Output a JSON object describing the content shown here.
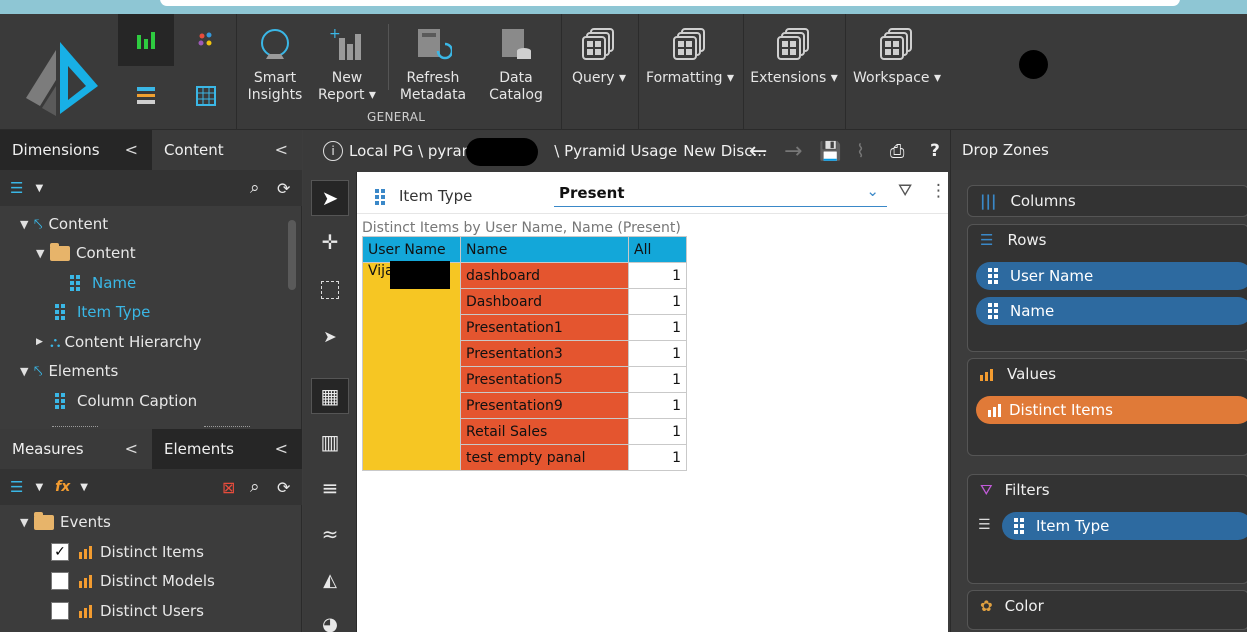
{
  "ribbon": {
    "buttons": [
      {
        "label": "Smart\nInsights"
      },
      {
        "label": "New\nReport ▾"
      },
      {
        "label": "Refresh\nMetadata"
      },
      {
        "label": "Data\nCatalog"
      },
      {
        "label": "Query ▾"
      },
      {
        "label": "Formatting ▾"
      },
      {
        "label": "Extensions ▾"
      },
      {
        "label": "Workspace ▾"
      }
    ],
    "group_label": "GENERAL"
  },
  "left": {
    "tab_dimensions": "Dimensions",
    "tab_content": "Content",
    "tree": [
      "Content",
      "Content",
      "Name",
      "Item Type",
      "Content Hierarchy",
      "Elements",
      "Column Caption"
    ],
    "tab_measures": "Measures",
    "tab_elements": "Elements",
    "measures_tree": [
      "Events",
      "Distinct Items",
      "Distinct Models",
      "Distinct Users"
    ],
    "checked": "✓"
  },
  "breadcrumb": {
    "part1": "Local PG \\ pyram",
    "part2": "\\ Pyramid Usage",
    "part3": "New Disc..."
  },
  "filter": {
    "label": "Item Type",
    "value": "Present"
  },
  "report": {
    "title": "Distinct Items by User Name, Name (Present)",
    "columns": [
      "User Name",
      "Name",
      "All"
    ],
    "user": "Vija",
    "rows": [
      {
        "name": "dashboard",
        "value": "1"
      },
      {
        "name": "Dashboard",
        "value": "1"
      },
      {
        "name": "Presentation1",
        "value": "1"
      },
      {
        "name": "Presentation3",
        "value": "1"
      },
      {
        "name": "Presentation5",
        "value": "1"
      },
      {
        "name": "Presentation9",
        "value": "1"
      },
      {
        "name": "Retail Sales",
        "value": "1"
      },
      {
        "name": "test empty panal",
        "value": "1"
      }
    ]
  },
  "dropzones": {
    "title": "Drop Zones",
    "columns": "Columns",
    "rows": "Rows",
    "rows_items": [
      "User Name",
      "Name"
    ],
    "values": "Values",
    "values_items": [
      "Distinct Items"
    ],
    "filters": "Filters",
    "filters_items": [
      "Item Type"
    ],
    "color": "Color"
  },
  "colors": {
    "accent": "#3ab7e6",
    "header_blue": "#13a7d9",
    "cell_orange": "#e4552f",
    "cell_yellow": "#f6c623",
    "pill_blue": "#2d6aa0",
    "pill_orange": "#e07a38"
  }
}
